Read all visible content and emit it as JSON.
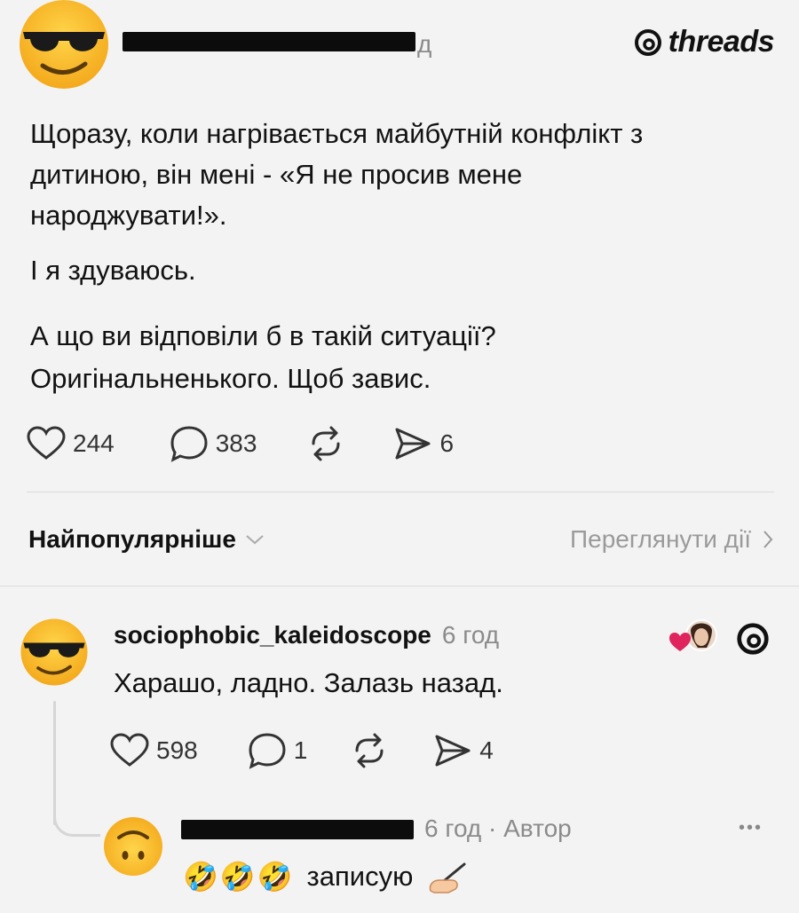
{
  "brand": {
    "name": "threads",
    "icon": "threads-logo-icon"
  },
  "post": {
    "author_avatar": "sunglasses-emoji",
    "time": "д",
    "paragraphs": [
      "Щоразу, коли нагрівається майбутній конфлікт з",
      "дитиною, він мені - «Я не просив мене",
      "народжувати!».",
      "І я здуваюсь.",
      "А що ви відповіли б в такій ситуації?",
      "Оригінальненького. Щоб завис."
    ],
    "likes": "244",
    "comments": "383",
    "shares": "6"
  },
  "sort": {
    "label": "Найпопулярніше",
    "activity_link": "Переглянути дії"
  },
  "comment1": {
    "username": "sociophobic_kaleidoscope",
    "time": "6 год",
    "text": "Харашо, ладно. Залазь назад.",
    "likes": "598",
    "replies": "1",
    "shares": "4"
  },
  "comment2": {
    "time": "6 год · Автор",
    "emojis": "🤣🤣🤣",
    "text": "записую",
    "more": "•••"
  },
  "colors": {
    "background": "#f3f3f3",
    "text": "#121212",
    "muted": "#8b8b8b",
    "heart": "#e0245e"
  }
}
